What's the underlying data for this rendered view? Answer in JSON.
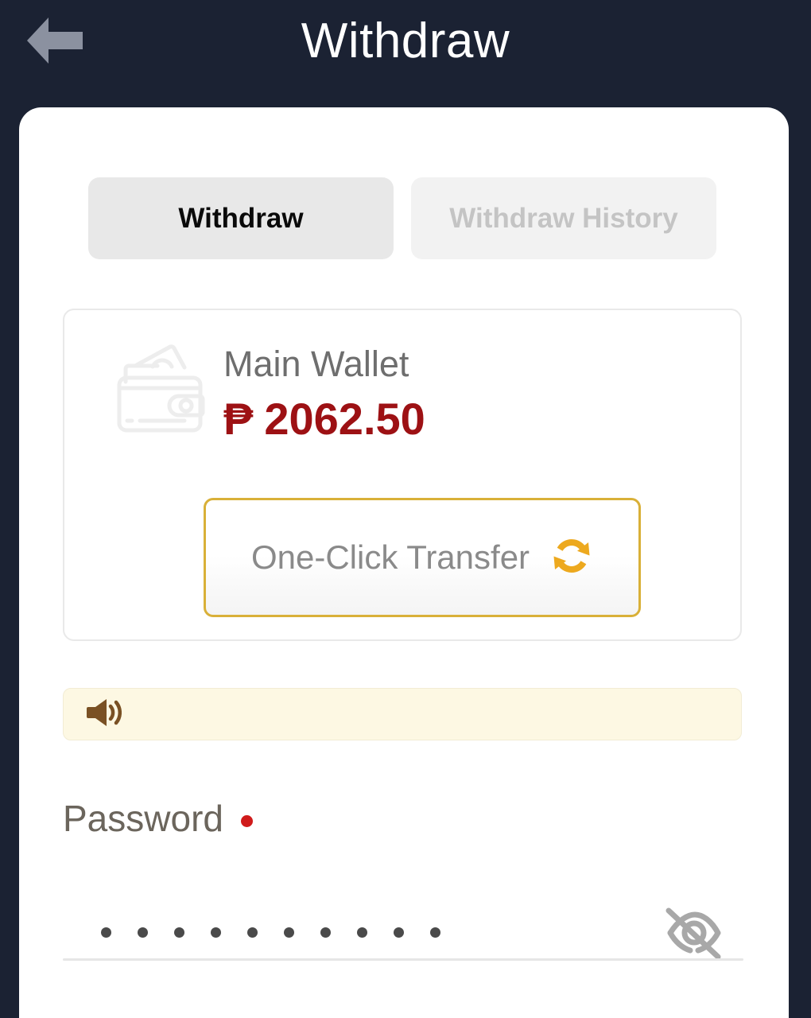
{
  "header": {
    "title": "Withdraw",
    "back_icon": "arrow-left-icon",
    "background_color": "#1b2233",
    "title_color": "#ffffff"
  },
  "tabs": [
    {
      "label": "Withdraw",
      "active": true
    },
    {
      "label": "Withdraw History",
      "active": false
    }
  ],
  "wallet": {
    "icon": "wallet-icon",
    "name": "Main Wallet",
    "currency_symbol": "₱",
    "balance": "2062.50",
    "balance_color": "#9d1114",
    "transfer": {
      "label": "One-Click Transfer",
      "icon": "sync-refresh-icon",
      "icon_color": "#eda91f",
      "border_color": "#d9b038"
    }
  },
  "announcement": {
    "icon": "speaker-announcement-icon",
    "icon_color": "#7a5124",
    "text": "",
    "background_color": "#fdf8e3"
  },
  "password": {
    "label": "Password",
    "required": true,
    "required_marker_color": "#d01b1b",
    "masked_value": "••••••••••",
    "masked_char_count": 10,
    "visible": false,
    "toggle_icon": "eye-off-icon",
    "toggle_icon_color": "#a8a8a8"
  }
}
